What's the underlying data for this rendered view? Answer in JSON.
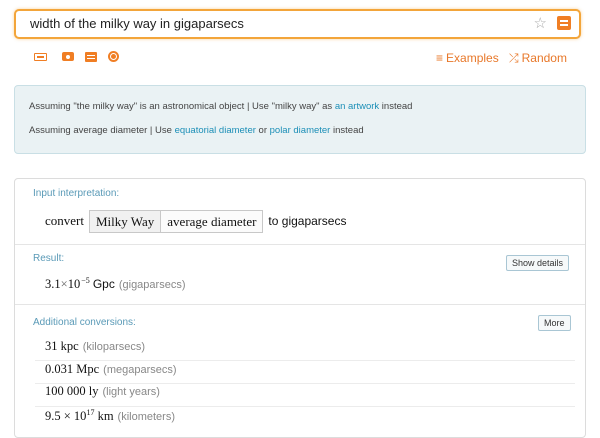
{
  "search": {
    "query": "width of the milky way in gigaparsecs"
  },
  "toolbar": {
    "icons": [
      "keyboard-icon",
      "camera-icon",
      "grid-icon",
      "shuffle-icon"
    ],
    "examples_label": "Examples",
    "random_label": "Random"
  },
  "assumptions": {
    "line1_prefix": "Assuming \"the milky way\" is an astronomical object | Use \"milky way\" as ",
    "line1_link": "an artwork",
    "line1_suffix": " instead",
    "line2_prefix": "Assuming average diameter | Use ",
    "line2_link1": "equatorial diameter",
    "line2_mid": " or ",
    "line2_link2": "polar diameter",
    "line2_suffix": " instead"
  },
  "interpretation": {
    "title": "Input interpretation:",
    "word": "convert",
    "cell1": "Milky Way",
    "cell2": "average diameter",
    "tail": "to gigaparsecs"
  },
  "result": {
    "title": "Result:",
    "button": "Show details",
    "mantissa": "3.1",
    "times": "×",
    "base": "10",
    "exponent": "−5",
    "unit": "Gpc",
    "unit_name": "(gigaparsecs)"
  },
  "conversions": {
    "title": "Additional conversions:",
    "button": "More",
    "rows": [
      {
        "value": "31 kpc",
        "note": "(kiloparsecs)"
      },
      {
        "value": "0.031 Mpc",
        "note": "(megaparsecs)"
      },
      {
        "value": "100 000 ly",
        "note": "(light years)"
      },
      {
        "value": "9.5 × 10",
        "exp": "17",
        "unit": " km",
        "note": "(kilometers)"
      }
    ]
  },
  "colors": {
    "accent": "#f07e24",
    "search_border": "#f3a53a",
    "link": "#1c8fb7",
    "pod_title": "#5a9ab7"
  }
}
